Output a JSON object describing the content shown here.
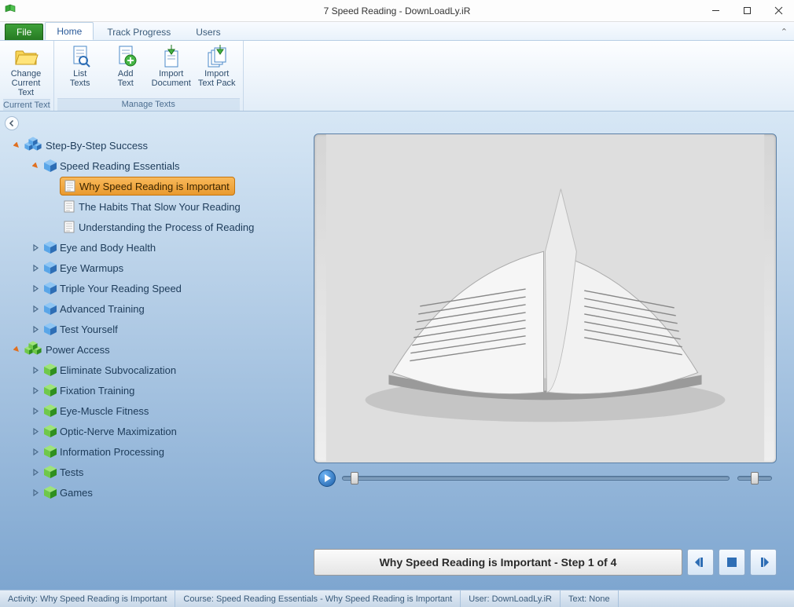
{
  "window": {
    "title": "7 Speed Reading - DownLoadLy.iR"
  },
  "menubar": {
    "file": "File",
    "tabs": [
      "Home",
      "Track Progress",
      "Users"
    ],
    "active": 0
  },
  "ribbon": {
    "groups": [
      {
        "label": "Current Text",
        "items": [
          {
            "icon": "folder",
            "line1": "Change",
            "line2": "Current Text",
            "name": "change-current-text-button"
          }
        ]
      },
      {
        "label": "Manage Texts",
        "items": [
          {
            "icon": "doc-mag",
            "line1": "List",
            "line2": "Texts",
            "name": "list-texts-button"
          },
          {
            "icon": "doc-plus",
            "line1": "Add",
            "line2": "Text",
            "name": "add-text-button"
          },
          {
            "icon": "doc-arrow",
            "line1": "Import",
            "line2": "Document",
            "name": "import-document-button"
          },
          {
            "icon": "pack-arrow",
            "line1": "Import",
            "line2": "Text Pack",
            "name": "import-text-pack-button"
          }
        ]
      }
    ]
  },
  "tree": [
    {
      "depth": 0,
      "tw": "open",
      "icon": "cube-blue-multi",
      "label": "Step-By-Step Success",
      "name": "course-step-by-step-success"
    },
    {
      "depth": 1,
      "tw": "open",
      "icon": "cube-blue",
      "label": "Speed Reading Essentials",
      "name": "section-speed-reading-essentials"
    },
    {
      "depth": 2,
      "tw": "none",
      "icon": "doc",
      "label": "Why Speed Reading is Important",
      "name": "lesson-why-important",
      "selected": true
    },
    {
      "depth": 2,
      "tw": "none",
      "icon": "doc",
      "label": "The Habits That Slow Your Reading",
      "name": "lesson-habits-slow"
    },
    {
      "depth": 2,
      "tw": "none",
      "icon": "doc",
      "label": "Understanding the Process of Reading",
      "name": "lesson-process"
    },
    {
      "depth": 1,
      "tw": "closed",
      "icon": "cube-blue",
      "label": "Eye and Body Health",
      "name": "section-eye-body-health"
    },
    {
      "depth": 1,
      "tw": "closed",
      "icon": "cube-blue",
      "label": "Eye Warmups",
      "name": "section-eye-warmups"
    },
    {
      "depth": 1,
      "tw": "closed",
      "icon": "cube-blue",
      "label": "Triple Your Reading Speed",
      "name": "section-triple-speed"
    },
    {
      "depth": 1,
      "tw": "closed",
      "icon": "cube-blue",
      "label": "Advanced Training",
      "name": "section-advanced-training"
    },
    {
      "depth": 1,
      "tw": "closed",
      "icon": "cube-blue",
      "label": "Test Yourself",
      "name": "section-test-yourself"
    },
    {
      "depth": 0,
      "tw": "open",
      "icon": "cube-green-multi",
      "label": "Power Access",
      "name": "course-power-access"
    },
    {
      "depth": 1,
      "tw": "closed",
      "icon": "cube-green",
      "label": "Eliminate Subvocalization",
      "name": "section-eliminate-sub"
    },
    {
      "depth": 1,
      "tw": "closed",
      "icon": "cube-green",
      "label": "Fixation Training",
      "name": "section-fixation"
    },
    {
      "depth": 1,
      "tw": "closed",
      "icon": "cube-green",
      "label": "Eye-Muscle Fitness",
      "name": "section-eye-muscle"
    },
    {
      "depth": 1,
      "tw": "closed",
      "icon": "cube-green",
      "label": "Optic-Nerve Maximization",
      "name": "section-optic-nerve"
    },
    {
      "depth": 1,
      "tw": "closed",
      "icon": "cube-green",
      "label": "Information Processing",
      "name": "section-info-processing"
    },
    {
      "depth": 1,
      "tw": "closed",
      "icon": "cube-green",
      "label": "Tests",
      "name": "section-tests"
    },
    {
      "depth": 1,
      "tw": "closed",
      "icon": "cube-green",
      "label": "Games",
      "name": "section-games"
    }
  ],
  "player": {
    "progress_pct": 3,
    "volume_pct": 50
  },
  "step": {
    "title": "Why Speed Reading is Important - Step 1 of 4"
  },
  "status": {
    "activity_label": "Activity:",
    "activity": "Why Speed Reading is Important",
    "course_label": "Course:",
    "course": "Speed Reading Essentials - Why Speed Reading is Important",
    "user_label": "User:",
    "user": "DownLoadLy.iR",
    "text_label": "Text:",
    "text": "None"
  }
}
